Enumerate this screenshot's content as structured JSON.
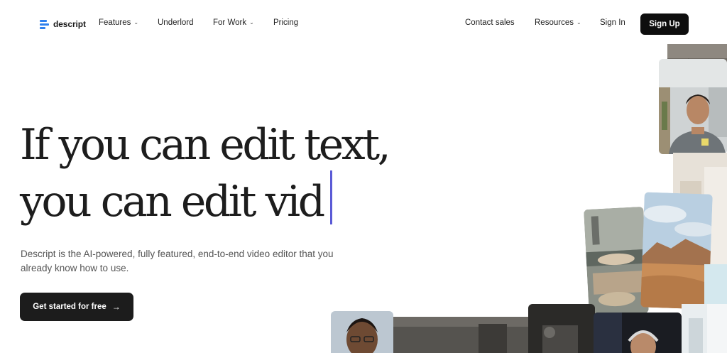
{
  "nav": {
    "logo_text": "descript",
    "links": [
      {
        "label": "Features",
        "dropdown": true
      },
      {
        "label": "Underlord",
        "dropdown": false
      },
      {
        "label": "For Work",
        "dropdown": true
      },
      {
        "label": "Pricing",
        "dropdown": false
      }
    ],
    "right_links": [
      {
        "label": "Contact sales",
        "dropdown": false
      },
      {
        "label": "Resources",
        "dropdown": true
      },
      {
        "label": "Sign In",
        "dropdown": false
      }
    ],
    "signup_label": "Sign Up",
    "chevron": "chevron-down-icon"
  },
  "hero": {
    "title_line1": "If you can edit text,",
    "title_line2": "you can edit vid",
    "subtitle": "Descript is the AI-powered, fully featured, end-to-end video editor that you already know how to use.",
    "cta_label": "Get started for free",
    "cta_icon": "arrow-right-icon"
  },
  "colors": {
    "brand_blue": "#2f80ed",
    "caret": "#5b5bd6",
    "button_dark": "#0e0e0e"
  }
}
